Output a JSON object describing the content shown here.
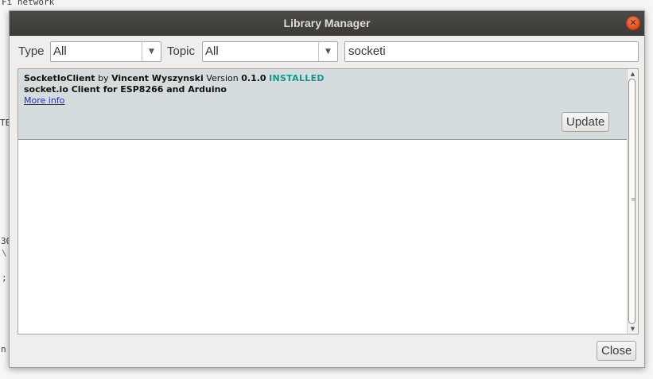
{
  "background_fragments": [
    "Fi network",
    "TE",
    "30",
    "\\",
    ";",
    "n"
  ],
  "dialog": {
    "title": "Library Manager",
    "close_glyph": "✕",
    "type_label": "Type",
    "type_value": "All",
    "topic_label": "Topic",
    "topic_value": "All",
    "search_value": "socketi"
  },
  "library": {
    "name": "SocketIoClient",
    "by": "by",
    "author": "Vincent Wyszynski",
    "version_label": "Version",
    "version": "0.1.0",
    "status": "INSTALLED",
    "description": "socket.io Client for ESP8266 and Arduino",
    "more_info": "More info",
    "update_label": "Update"
  },
  "footer": {
    "close_label": "Close"
  },
  "icons": {
    "dropdown": "chevron-down-icon",
    "close": "close-icon"
  },
  "colors": {
    "titlebar": "#3c3b37",
    "close_button": "#df4b16",
    "selected_item": "#d5dcdd",
    "installed": "#12968e",
    "link": "#1a2fd1"
  }
}
